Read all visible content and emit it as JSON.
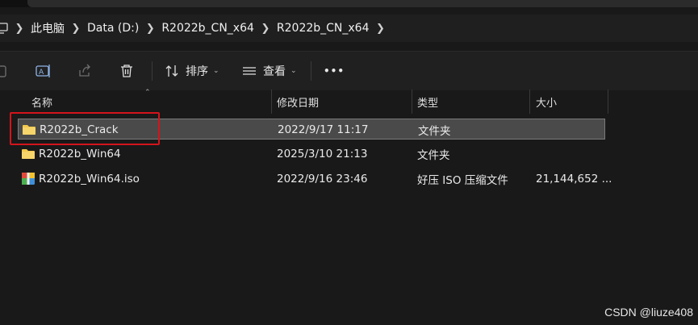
{
  "breadcrumb": {
    "items": [
      "此电脑",
      "Data (D:)",
      "R2022b_CN_x64",
      "R2022b_CN_x64"
    ]
  },
  "toolbar": {
    "sort_label": "排序",
    "view_label": "查看",
    "more_label": "•••"
  },
  "columns": {
    "name": "名称",
    "modified": "修改日期",
    "type": "类型",
    "size": "大小"
  },
  "files": [
    {
      "name": "R2022b_Crack",
      "modified": "2022/9/17 11:17",
      "type": "文件夹",
      "size": "",
      "icon": "folder-icon",
      "selected": true
    },
    {
      "name": "R2022b_Win64",
      "modified": "2025/3/10 21:13",
      "type": "文件夹",
      "size": "",
      "icon": "folder-icon",
      "selected": false
    },
    {
      "name": "R2022b_Win64.iso",
      "modified": "2022/9/16 23:46",
      "type": "好压 ISO 压缩文件",
      "size": "21,144,652 ...",
      "icon": "archive-file-icon",
      "selected": false
    }
  ],
  "watermark": "CSDN @liuze408",
  "colors": {
    "background": "#191919",
    "selection": "#4a4a4a",
    "highlight_box": "#d4141c",
    "folder": "#f2c94c"
  }
}
